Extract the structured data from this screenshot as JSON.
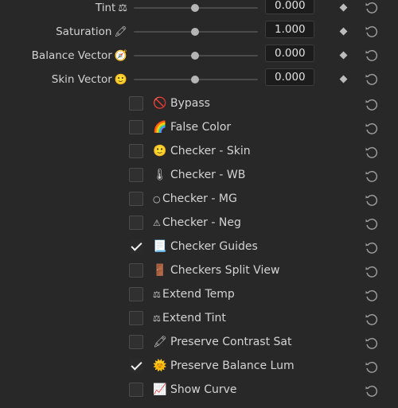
{
  "sliders": [
    {
      "label": "Tint",
      "icon": "⚖",
      "icon_name": "balance-scale-icon",
      "value": "0.000"
    },
    {
      "label": "Saturation",
      "icon": "🖍",
      "icon_name": "crayon-icon",
      "value": "1.000"
    },
    {
      "label": "Balance Vector",
      "icon": "🧭",
      "icon_name": "compass-icon",
      "value": "0.000"
    },
    {
      "label": "Skin Vector",
      "icon": "🙂",
      "icon_name": "smiley-icon",
      "value": "0.000"
    }
  ],
  "checkboxes": [
    {
      "label": "Bypass",
      "icon": "🚫",
      "icon_name": "prohibited-icon",
      "checked": false
    },
    {
      "label": "False Color",
      "icon": "🌈",
      "icon_name": "rainbow-icon",
      "checked": false
    },
    {
      "label": "Checker - Skin",
      "icon": "🙂",
      "icon_name": "smiley-icon",
      "checked": false
    },
    {
      "label": "Checker - WB",
      "icon": "🌡",
      "icon_name": "thermometer-icon",
      "checked": false
    },
    {
      "label": "Checker - MG",
      "icon": "○",
      "icon_name": "circle-icon",
      "checked": false
    },
    {
      "label": "Checker - Neg",
      "icon": "⚠",
      "icon_name": "warning-icon",
      "checked": false
    },
    {
      "label": "Checker Guides",
      "icon": "📃",
      "icon_name": "page-icon",
      "checked": true
    },
    {
      "label": "Checkers Split View",
      "icon": "🚪",
      "icon_name": "door-icon",
      "checked": false
    },
    {
      "label": "Extend Temp",
      "icon": "⚖",
      "icon_name": "balance-scale-icon",
      "checked": false
    },
    {
      "label": "Extend Tint",
      "icon": "⚖",
      "icon_name": "balance-scale-icon",
      "checked": false
    },
    {
      "label": "Preserve Contrast Sat",
      "icon": "🖍",
      "icon_name": "crayon-icon",
      "checked": false
    },
    {
      "label": "Preserve Balance Lum",
      "icon": "🌞",
      "icon_name": "sun-icon",
      "checked": true
    },
    {
      "label": "Show Curve",
      "icon": "📈",
      "icon_name": "chart-icon",
      "checked": false
    }
  ],
  "colors": {
    "background": "#282828",
    "text": "#d4d4d4",
    "field": "#1c1c1c"
  }
}
